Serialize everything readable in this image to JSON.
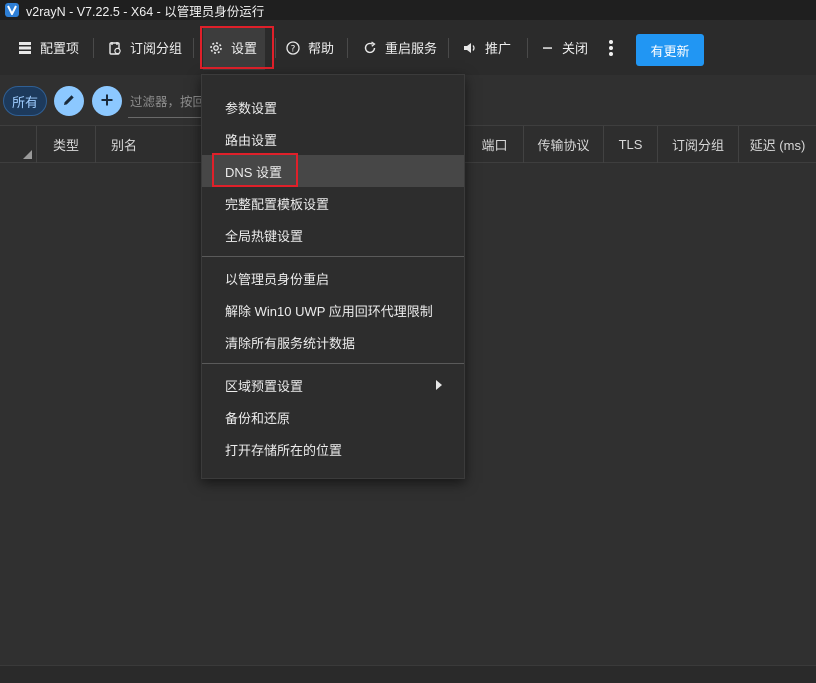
{
  "window": {
    "title": "v2rayN - V7.22.5 - X64 - 以管理员身份运行"
  },
  "toolbar": {
    "items": [
      {
        "label": "配置项",
        "icon": "server-icon"
      },
      {
        "label": "订阅分组",
        "icon": "subscription-icon"
      },
      {
        "label": "设置",
        "icon": "gear-icon"
      },
      {
        "label": "帮助",
        "icon": "help-icon"
      },
      {
        "label": "重启服务",
        "icon": "restart-icon"
      },
      {
        "label": "推广",
        "icon": "speaker-icon"
      },
      {
        "label": "关闭",
        "icon": "minus-icon"
      }
    ],
    "more_icon": "more-vertical-icon",
    "update_button": "有更新"
  },
  "filterbar": {
    "chip_all": "所有",
    "edit_icon": "pencil-icon",
    "add_icon": "plus-icon",
    "filter_placeholder": "过滤器，按回车"
  },
  "table": {
    "columns": [
      "类型",
      "别名",
      "端口",
      "传输协议",
      "TLS",
      "订阅分组",
      "延迟 (ms)"
    ]
  },
  "settings_menu": {
    "groups": [
      [
        "参数设置",
        "路由设置",
        "DNS 设置",
        "完整配置模板设置",
        "全局热键设置"
      ],
      [
        "以管理员身份重启",
        "解除 Win10 UWP 应用回环代理限制",
        "清除所有服务统计数据"
      ],
      [
        "区域预置设置",
        "备份和还原",
        "打开存储所在的位置"
      ]
    ],
    "highlighted_item": "DNS 设置",
    "submenu_item": "区域预置设置"
  },
  "colors": {
    "accent": "#2196f3",
    "highlight_border": "#e0202a",
    "background": "#303030",
    "menu_background": "#2d2d2d"
  }
}
